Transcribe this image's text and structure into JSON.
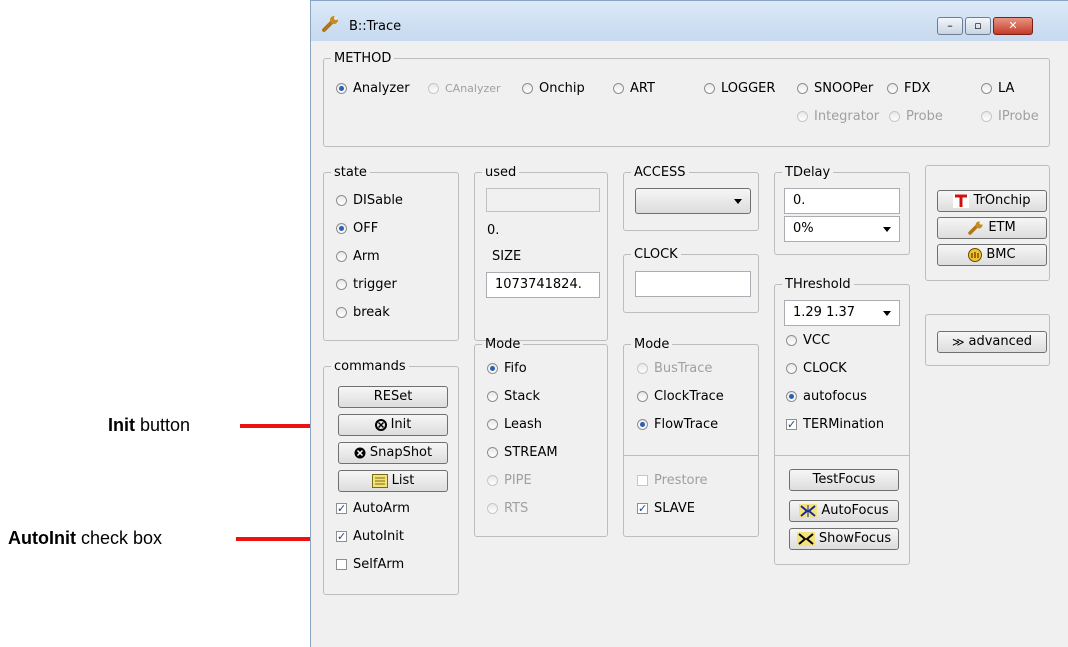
{
  "annotations": {
    "init": {
      "bold": "Init",
      "rest": " button"
    },
    "autoinit": {
      "bold": "AutoInit",
      "rest": " check box"
    }
  },
  "window": {
    "title": "B::Trace",
    "minimize_glyph": "–",
    "maximize_glyph": "▫",
    "close_glyph": "✕"
  },
  "method": {
    "legend": "METHOD",
    "options": [
      {
        "label": "Analyzer",
        "checked": true,
        "enabled": true
      },
      {
        "label": "CAnalyzer",
        "checked": false,
        "enabled": false
      },
      {
        "label": "Onchip",
        "checked": false,
        "enabled": true
      },
      {
        "label": "ART",
        "checked": false,
        "enabled": true
      },
      {
        "label": "LOGGER",
        "checked": false,
        "enabled": true
      },
      {
        "label": "SNOOPer",
        "checked": false,
        "enabled": true
      },
      {
        "label": "FDX",
        "checked": false,
        "enabled": true
      },
      {
        "label": "LA",
        "checked": false,
        "enabled": true
      },
      {
        "label": "Integrator",
        "checked": false,
        "enabled": false
      },
      {
        "label": "Probe",
        "checked": false,
        "enabled": false
      },
      {
        "label": "IProbe",
        "checked": false,
        "enabled": false
      }
    ]
  },
  "state": {
    "legend": "state",
    "options": [
      {
        "label": "DISable",
        "checked": false
      },
      {
        "label": "OFF",
        "checked": true
      },
      {
        "label": "Arm",
        "checked": false
      },
      {
        "label": "trigger",
        "checked": false
      },
      {
        "label": "break",
        "checked": false
      }
    ]
  },
  "commands": {
    "legend": "commands",
    "buttons": {
      "reset": "RESet",
      "init": "Init",
      "snapshot": "SnapShot",
      "list": "List"
    },
    "checks": [
      {
        "label": "AutoArm",
        "checked": true
      },
      {
        "label": "AutoInit",
        "checked": true
      },
      {
        "label": "SelfArm",
        "checked": false
      }
    ]
  },
  "used": {
    "legend": "used",
    "value": "0."
  },
  "size": {
    "legend": "SIZE",
    "value": "1073741824."
  },
  "buffer_mode": {
    "legend": "Mode",
    "options": [
      {
        "label": "Fifo",
        "checked": true,
        "enabled": true
      },
      {
        "label": "Stack",
        "checked": false,
        "enabled": true
      },
      {
        "label": "Leash",
        "checked": false,
        "enabled": true
      },
      {
        "label": "STREAM",
        "checked": false,
        "enabled": true
      },
      {
        "label": "PIPE",
        "checked": false,
        "enabled": false
      },
      {
        "label": "RTS",
        "checked": false,
        "enabled": false
      }
    ]
  },
  "access": {
    "legend": "ACCESS",
    "value": ""
  },
  "clock": {
    "legend": "CLOCK",
    "value": ""
  },
  "trace_mode": {
    "legend": "Mode",
    "options": [
      {
        "label": "BusTrace",
        "checked": false,
        "enabled": false
      },
      {
        "label": "ClockTrace",
        "checked": false,
        "enabled": true
      },
      {
        "label": "FlowTrace",
        "checked": true,
        "enabled": true
      }
    ],
    "checks": [
      {
        "label": "Prestore",
        "checked": false,
        "enabled": false
      },
      {
        "label": "SLAVE",
        "checked": true,
        "enabled": true
      }
    ]
  },
  "tdelay": {
    "legend": "TDelay",
    "value": "0.",
    "percent": "0%"
  },
  "threshold": {
    "legend": "THreshold",
    "value": "1.29 1.37",
    "options": [
      {
        "label": "VCC",
        "checked": false
      },
      {
        "label": "CLOCK",
        "checked": false
      },
      {
        "label": "autofocus",
        "checked": true
      }
    ],
    "termination": {
      "label": "TERMination",
      "checked": true
    },
    "buttons": {
      "testfocus": "TestFocus",
      "autofocus": "AutoFocus",
      "showfocus": "ShowFocus"
    }
  },
  "side_buttons": {
    "tronchip": "TrOnchip",
    "etm": "ETM",
    "bmc": "BMC",
    "advanced": "advanced"
  },
  "colors": {
    "accent_red": "#ee1111",
    "title_bar": "#c6d9ef",
    "radio_dot": "#2a5fb4"
  }
}
